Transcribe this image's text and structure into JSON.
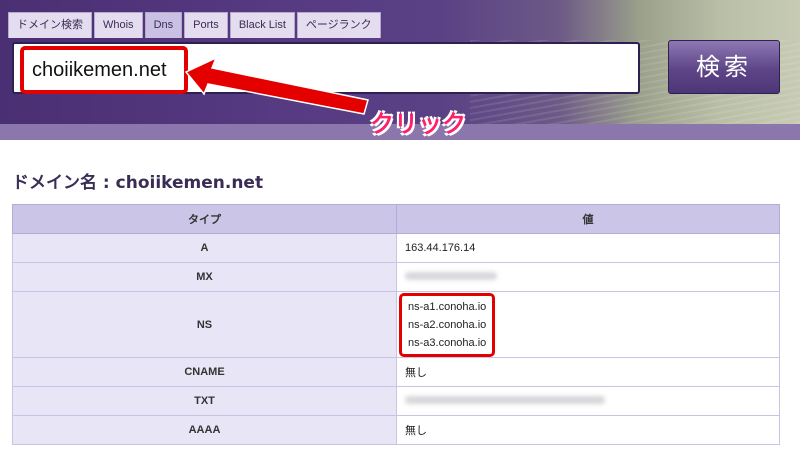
{
  "tabs": [
    {
      "label": "ドメイン検索"
    },
    {
      "label": "Whois"
    },
    {
      "label": "Dns"
    },
    {
      "label": "Ports"
    },
    {
      "label": "Black List"
    },
    {
      "label": "ページランク"
    }
  ],
  "search": {
    "value": "choiikemen.net",
    "button_label": "検索"
  },
  "annotation": {
    "label": "クリック",
    "color": "#e50000"
  },
  "result": {
    "title": "ドメイン名 : choiikemen.net",
    "columns": [
      "タイプ",
      "値"
    ],
    "rows": [
      {
        "type": "A",
        "values": [
          "163.44.176.14"
        ]
      },
      {
        "type": "MX",
        "values": []
      },
      {
        "type": "NS",
        "values": [
          "ns-a1.conoha.io",
          "ns-a2.conoha.io",
          "ns-a3.conoha.io"
        ]
      },
      {
        "type": "CNAME",
        "values": [
          "無し"
        ]
      },
      {
        "type": "TXT",
        "values": []
      },
      {
        "type": "AAAA",
        "values": [
          "無し"
        ]
      }
    ]
  },
  "colors": {
    "brand": "#4a2f73",
    "table_header": "#cbc5e8",
    "highlight": "#e50000"
  }
}
